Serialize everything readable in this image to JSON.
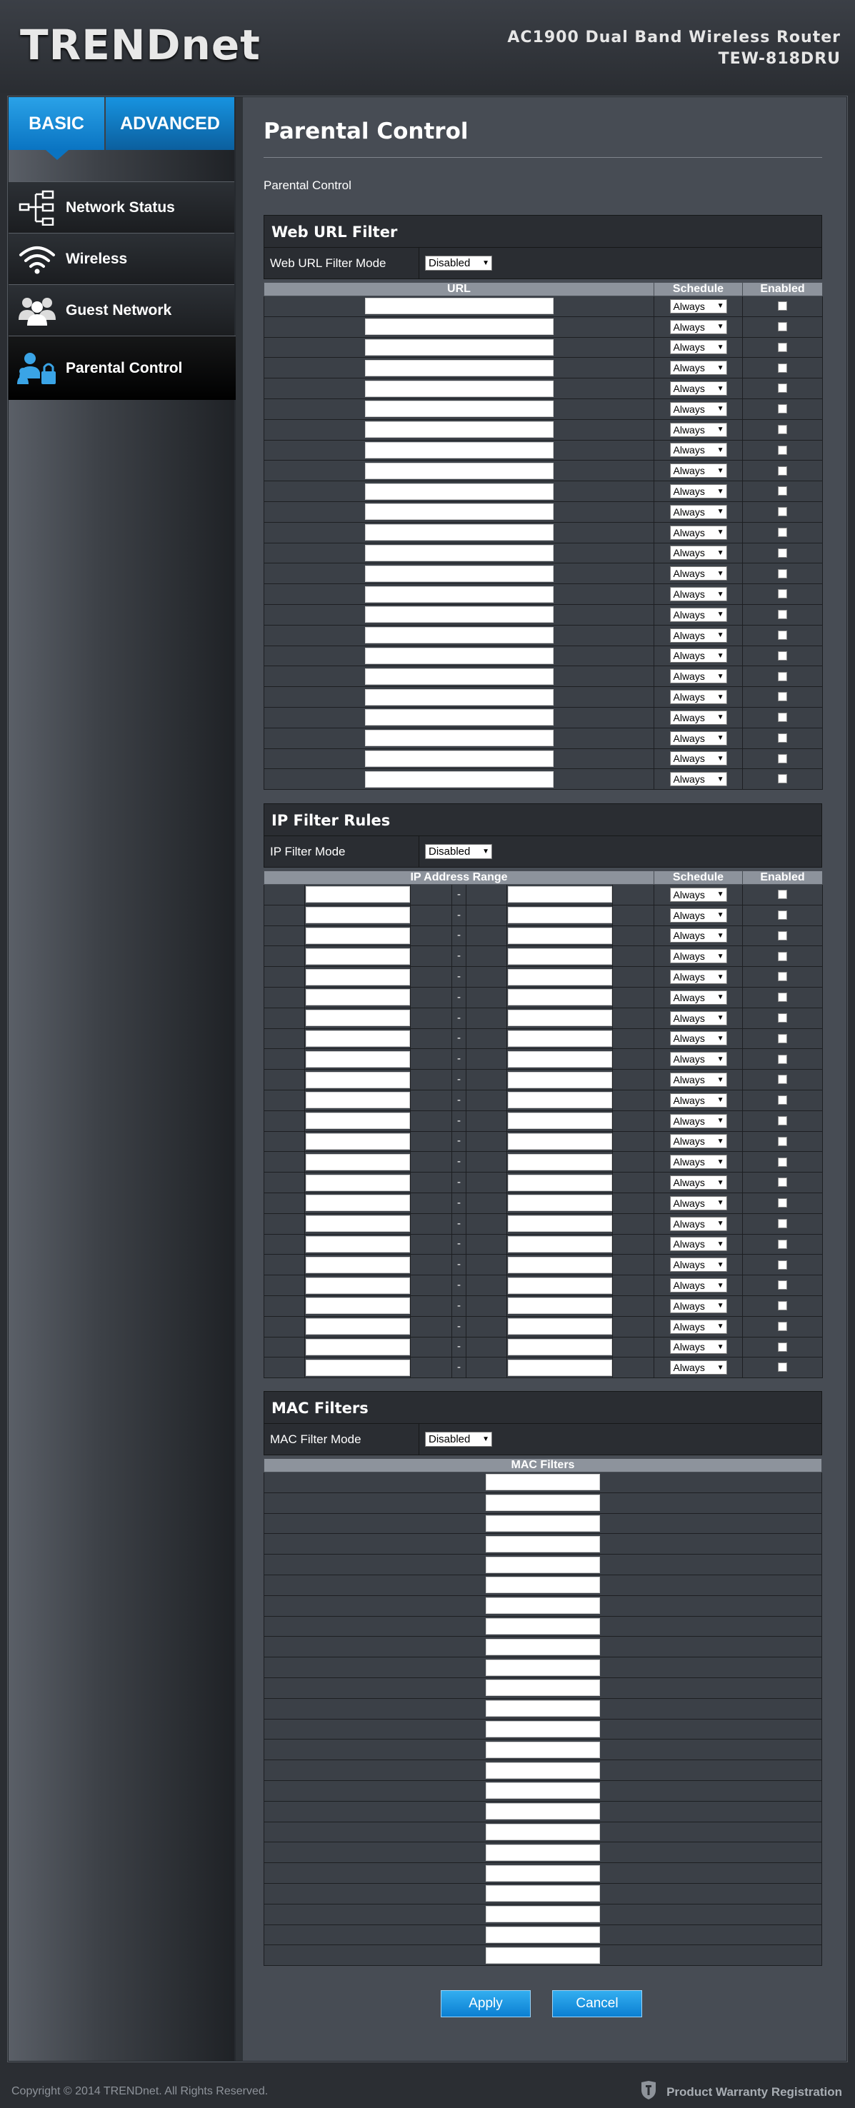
{
  "header": {
    "brand": "TRENDnet",
    "product_line": "AC1900 Dual Band Wireless Router",
    "model": "TEW-818DRU"
  },
  "tabs": [
    {
      "label": "BASIC",
      "active": true
    },
    {
      "label": "ADVANCED",
      "active": false
    }
  ],
  "sidebar": {
    "items": [
      {
        "label": "Network Status",
        "icon": "network-tree-icon",
        "active": false
      },
      {
        "label": "Wireless",
        "icon": "wifi-icon",
        "active": false
      },
      {
        "label": "Guest Network",
        "icon": "users-icon",
        "active": false
      },
      {
        "label": "Parental Control",
        "icon": "parent-lock-icon",
        "active": true
      }
    ]
  },
  "page": {
    "title": "Parental Control",
    "breadcrumb": "Parental Control"
  },
  "url_filter": {
    "heading": "Web URL Filter",
    "mode_label": "Web URL Filter Mode",
    "mode_value": "Disabled",
    "columns": [
      "URL",
      "Schedule",
      "Enabled"
    ],
    "row_count": 24,
    "schedule_default": "Always"
  },
  "ip_filter": {
    "heading": "IP Filter Rules",
    "mode_label": "IP Filter Mode",
    "mode_value": "Disabled",
    "columns": [
      "IP Address Range",
      "Schedule",
      "Enabled"
    ],
    "separator": "-",
    "row_count": 24,
    "schedule_default": "Always"
  },
  "mac_filter": {
    "heading": "MAC Filters",
    "mode_label": "MAC Filter Mode",
    "mode_value": "Disabled",
    "columns": [
      "MAC Filters"
    ],
    "row_count": 24
  },
  "buttons": {
    "apply": "Apply",
    "cancel": "Cancel"
  },
  "footer": {
    "copyright": "Copyright © 2014 TRENDnet. All Rights Reserved.",
    "warranty": "Product Warranty Registration"
  },
  "colors": {
    "accent": "#0b7fd2",
    "panel": "#474c54",
    "section_header": "#2a2d32"
  }
}
